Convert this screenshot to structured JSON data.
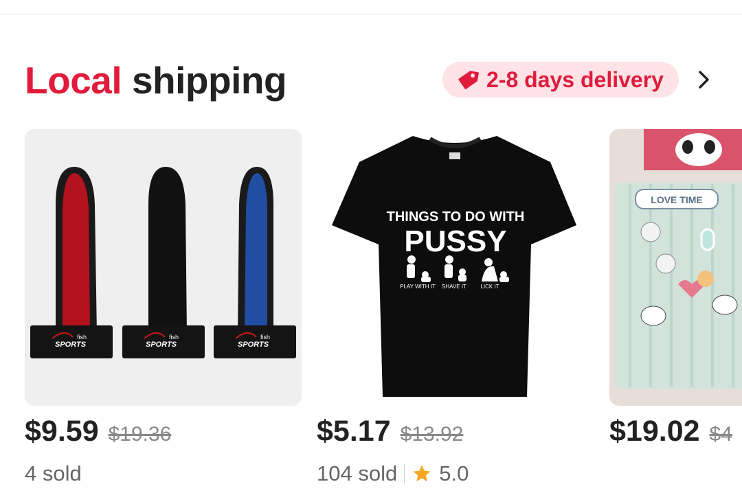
{
  "section": {
    "title_accent": "Local",
    "title_rest": "shipping",
    "delivery_badge": "2-8 days delivery",
    "accent_color": "#e01b3c",
    "badge_bg": "#ffe3e6"
  },
  "products": [
    {
      "image_icon": "finger-protector-icon",
      "image_brand": "fish",
      "image_brand_sub": "SPORTS",
      "price": "$9.59",
      "original_price": "$19.36",
      "sold": "4 sold"
    },
    {
      "image_icon": "tshirt-icon",
      "shirt_line1": "THINGS TO DO WITH",
      "shirt_line2": "PUSSY",
      "shirt_captions": [
        "PLAY WITH IT",
        "SHAVE IT",
        "LICK IT"
      ],
      "price": "$5.17",
      "original_price": "$13.92",
      "sold": "104 sold",
      "rating": "5.0"
    },
    {
      "image_icon": "photo-album-icon",
      "album_label": "LOVE TIME",
      "price": "$19.02",
      "original_price": "$4"
    }
  ]
}
